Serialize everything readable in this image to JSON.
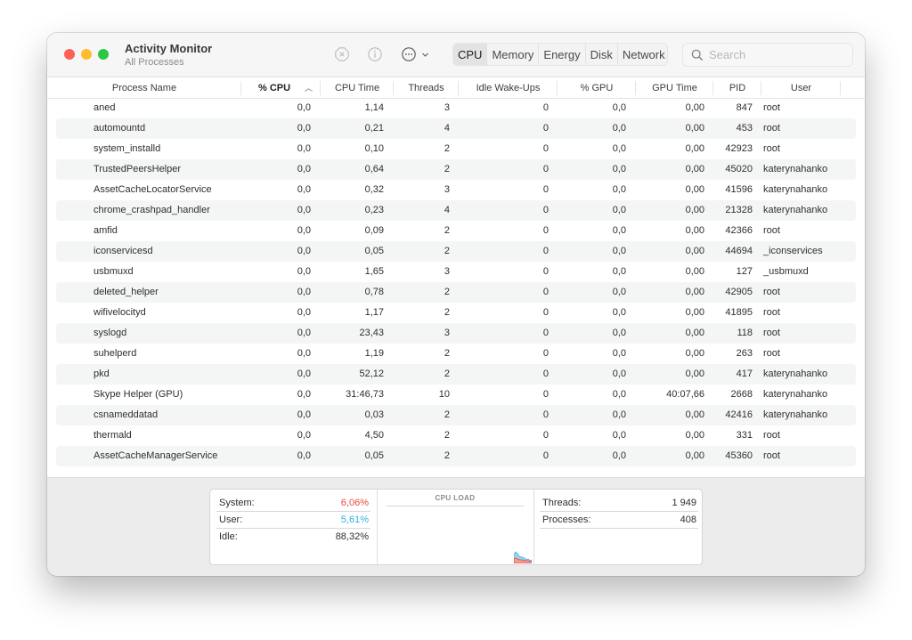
{
  "window": {
    "title": "Activity Monitor",
    "subtitle": "All Processes"
  },
  "toolbar": {
    "stop_icon": "stop-process-icon",
    "info_icon": "info-icon",
    "more_icon": "ellipsis-circle-icon",
    "more_chevron": "chevron-down-icon",
    "tabs": [
      {
        "label": "CPU",
        "active": true
      },
      {
        "label": "Memory",
        "active": false
      },
      {
        "label": "Energy",
        "active": false
      },
      {
        "label": "Disk",
        "active": false
      },
      {
        "label": "Network",
        "active": false
      }
    ],
    "search_placeholder": "Search",
    "search_value": ""
  },
  "table": {
    "columns": [
      "Process Name",
      "% CPU",
      "CPU Time",
      "Threads",
      "Idle Wake-Ups",
      "% GPU",
      "GPU Time",
      "PID",
      "User"
    ],
    "sort_column": "% CPU",
    "sort_indicator": "^",
    "rows": [
      {
        "name": "aned",
        "cpu": "0,0",
        "cpu_time": "1,14",
        "threads": "3",
        "idle": "0",
        "gpu": "0,0",
        "gpu_time": "0,00",
        "pid": "847",
        "user": "root"
      },
      {
        "name": "automountd",
        "cpu": "0,0",
        "cpu_time": "0,21",
        "threads": "4",
        "idle": "0",
        "gpu": "0,0",
        "gpu_time": "0,00",
        "pid": "453",
        "user": "root"
      },
      {
        "name": "system_installd",
        "cpu": "0,0",
        "cpu_time": "0,10",
        "threads": "2",
        "idle": "0",
        "gpu": "0,0",
        "gpu_time": "0,00",
        "pid": "42923",
        "user": "root"
      },
      {
        "name": "TrustedPeersHelper",
        "cpu": "0,0",
        "cpu_time": "0,64",
        "threads": "2",
        "idle": "0",
        "gpu": "0,0",
        "gpu_time": "0,00",
        "pid": "45020",
        "user": "katerynahanko"
      },
      {
        "name": "AssetCacheLocatorService",
        "cpu": "0,0",
        "cpu_time": "0,32",
        "threads": "3",
        "idle": "0",
        "gpu": "0,0",
        "gpu_time": "0,00",
        "pid": "41596",
        "user": "katerynahanko"
      },
      {
        "name": "chrome_crashpad_handler",
        "cpu": "0,0",
        "cpu_time": "0,23",
        "threads": "4",
        "idle": "0",
        "gpu": "0,0",
        "gpu_time": "0,00",
        "pid": "21328",
        "user": "katerynahanko"
      },
      {
        "name": "amfid",
        "cpu": "0,0",
        "cpu_time": "0,09",
        "threads": "2",
        "idle": "0",
        "gpu": "0,0",
        "gpu_time": "0,00",
        "pid": "42366",
        "user": "root"
      },
      {
        "name": "iconservicesd",
        "cpu": "0,0",
        "cpu_time": "0,05",
        "threads": "2",
        "idle": "0",
        "gpu": "0,0",
        "gpu_time": "0,00",
        "pid": "44694",
        "user": "_iconservices"
      },
      {
        "name": "usbmuxd",
        "cpu": "0,0",
        "cpu_time": "1,65",
        "threads": "3",
        "idle": "0",
        "gpu": "0,0",
        "gpu_time": "0,00",
        "pid": "127",
        "user": "_usbmuxd"
      },
      {
        "name": "deleted_helper",
        "cpu": "0,0",
        "cpu_time": "0,78",
        "threads": "2",
        "idle": "0",
        "gpu": "0,0",
        "gpu_time": "0,00",
        "pid": "42905",
        "user": "root"
      },
      {
        "name": "wifivelocityd",
        "cpu": "0,0",
        "cpu_time": "1,17",
        "threads": "2",
        "idle": "0",
        "gpu": "0,0",
        "gpu_time": "0,00",
        "pid": "41895",
        "user": "root"
      },
      {
        "name": "syslogd",
        "cpu": "0,0",
        "cpu_time": "23,43",
        "threads": "3",
        "idle": "0",
        "gpu": "0,0",
        "gpu_time": "0,00",
        "pid": "118",
        "user": "root"
      },
      {
        "name": "suhelperd",
        "cpu": "0,0",
        "cpu_time": "1,19",
        "threads": "2",
        "idle": "0",
        "gpu": "0,0",
        "gpu_time": "0,00",
        "pid": "263",
        "user": "root"
      },
      {
        "name": "pkd",
        "cpu": "0,0",
        "cpu_time": "52,12",
        "threads": "2",
        "idle": "0",
        "gpu": "0,0",
        "gpu_time": "0,00",
        "pid": "417",
        "user": "katerynahanko"
      },
      {
        "name": "Skype Helper (GPU)",
        "cpu": "0,0",
        "cpu_time": "31:46,73",
        "threads": "10",
        "idle": "0",
        "gpu": "0,0",
        "gpu_time": "40:07,66",
        "pid": "2668",
        "user": "katerynahanko"
      },
      {
        "name": "csnameddatad",
        "cpu": "0,0",
        "cpu_time": "0,03",
        "threads": "2",
        "idle": "0",
        "gpu": "0,0",
        "gpu_time": "0,00",
        "pid": "42416",
        "user": "katerynahanko"
      },
      {
        "name": "thermald",
        "cpu": "0,0",
        "cpu_time": "4,50",
        "threads": "2",
        "idle": "0",
        "gpu": "0,0",
        "gpu_time": "0,00",
        "pid": "331",
        "user": "root"
      },
      {
        "name": "AssetCacheManagerService",
        "cpu": "0,0",
        "cpu_time": "0,05",
        "threads": "2",
        "idle": "0",
        "gpu": "0,0",
        "gpu_time": "0,00",
        "pid": "45360",
        "user": "root"
      }
    ]
  },
  "summary": {
    "system_label": "System:",
    "system_value": "6,06%",
    "user_label": "User:",
    "user_value": "5,61%",
    "idle_label": "Idle:",
    "idle_value": "88,32%",
    "cpu_load_title": "CPU LOAD",
    "threads_label": "Threads:",
    "threads_value": "1 949",
    "processes_label": "Processes:",
    "processes_value": "408",
    "colors": {
      "system": "#ef4a3c",
      "user": "#35aee6"
    }
  }
}
